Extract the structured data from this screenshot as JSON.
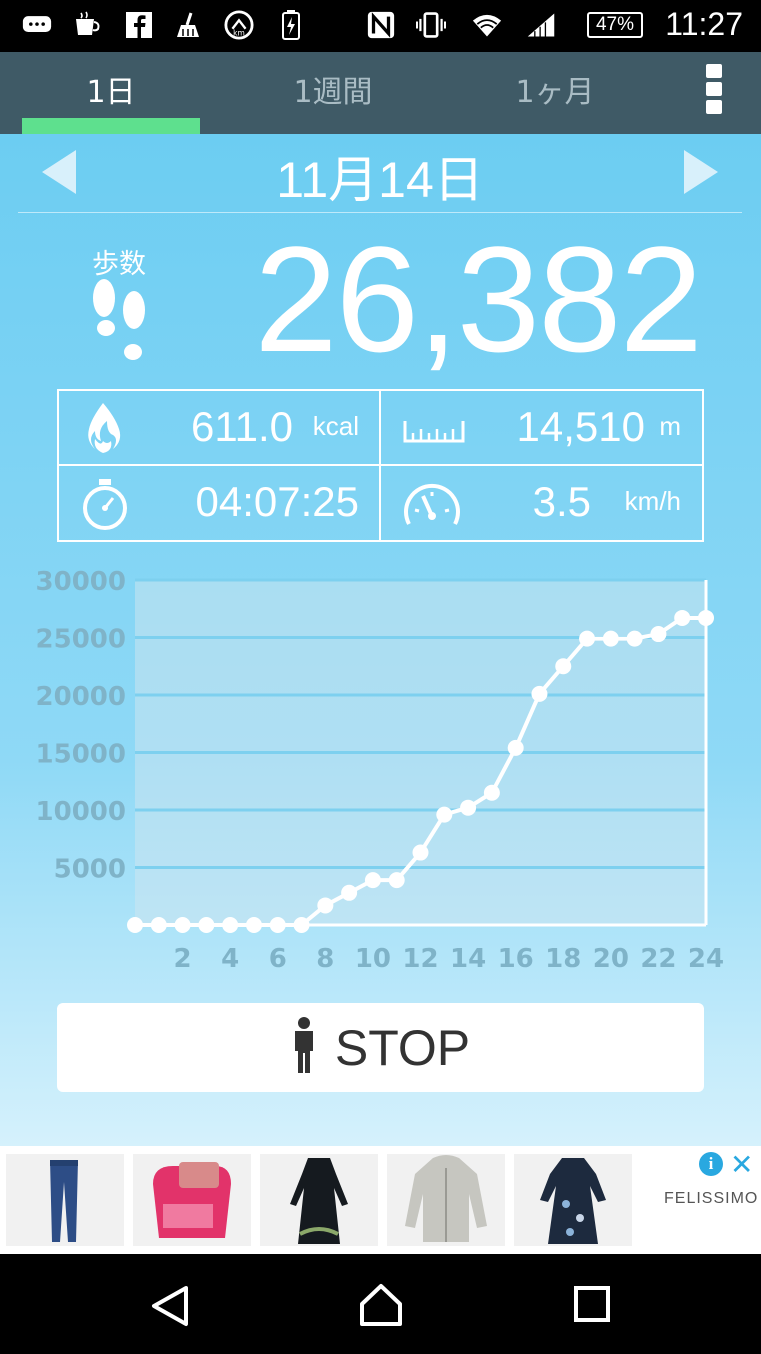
{
  "status_bar": {
    "time": "11:27",
    "battery": "47%",
    "icons": [
      "chat-icon",
      "coffee-icon",
      "facebook-icon",
      "broom-icon",
      "speedometer-icon",
      "battery-charging-icon",
      "nfc-icon",
      "vibrate-icon",
      "wifi-icon",
      "signal-icon"
    ]
  },
  "tabs": [
    {
      "label": "1日",
      "active": true
    },
    {
      "label": "1週間",
      "active": false
    },
    {
      "label": "1ヶ月",
      "active": false
    }
  ],
  "date": "11月14日",
  "steps": {
    "label": "歩数",
    "value": "26,382"
  },
  "stats": {
    "calories": {
      "value": "611.0",
      "unit": "kcal",
      "icon": "flame-icon"
    },
    "distance": {
      "value": "14,510",
      "unit": "m",
      "icon": "ruler-icon"
    },
    "time": {
      "value": "04:07:25",
      "icon": "stopwatch-icon"
    },
    "speed": {
      "value": "3.5",
      "unit": "km/h",
      "icon": "speedometer-icon"
    }
  },
  "chart_data": {
    "type": "line",
    "x": [
      0,
      1,
      2,
      3,
      4,
      5,
      6,
      7,
      8,
      9,
      10,
      11,
      12,
      13,
      14,
      15,
      16,
      17,
      18,
      19,
      20,
      21,
      22,
      23,
      24
    ],
    "values": [
      0,
      0,
      0,
      0,
      0,
      0,
      0,
      0,
      1700,
      2800,
      3900,
      3900,
      6300,
      9600,
      10200,
      11500,
      15400,
      20100,
      22500,
      24900,
      24900,
      24900,
      25300,
      26700,
      26700
    ],
    "xticks": [
      "2",
      "4",
      "6",
      "8",
      "10",
      "12",
      "14",
      "16",
      "18",
      "20",
      "22",
      "24"
    ],
    "yticks": [
      "30000",
      "25000",
      "20000",
      "15000",
      "10000",
      "5000"
    ],
    "ylim": [
      0,
      30000
    ],
    "xlim": [
      0,
      24
    ],
    "grid": true,
    "colors": {
      "line": "#ffffff",
      "grid": "#7dd0ef",
      "plot_bg": "#cfe6f0"
    }
  },
  "stop_button": {
    "label": "STOP",
    "icon": "person-icon"
  },
  "ad": {
    "brand": "FELISSIMO",
    "items": [
      "jeans-image",
      "pink-bag-image",
      "black-dress-image",
      "gray-hoodie-image",
      "floral-dress-image"
    ]
  },
  "nav": [
    "back-icon",
    "home-icon",
    "recents-icon"
  ]
}
